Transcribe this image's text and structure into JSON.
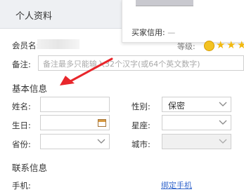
{
  "header": {
    "title": "个人资料"
  },
  "popup": {
    "buyer_credit_label": "买家信用:",
    "buyer_credit_value": "—"
  },
  "profile": {
    "member_label": "会员名:",
    "grade_label": "等级:",
    "note_label": "备注:",
    "note_placeholder": "备注最多只能输入32个汉字(或64个英文数字)"
  },
  "basic_info": {
    "title": "基本信息",
    "name_label": "姓名:",
    "gender_label": "性别:",
    "gender_value": "保密",
    "birthday_label": "生日:",
    "constellation_label": "星座:",
    "province_label": "省份:",
    "city_label": "城市:"
  },
  "contact_info": {
    "title": "联系信息",
    "phone_label": "手机:",
    "bind_phone_link": "绑定手机"
  },
  "colors": {
    "accent_red": "#e8262b",
    "link_blue": "#3366cc"
  }
}
